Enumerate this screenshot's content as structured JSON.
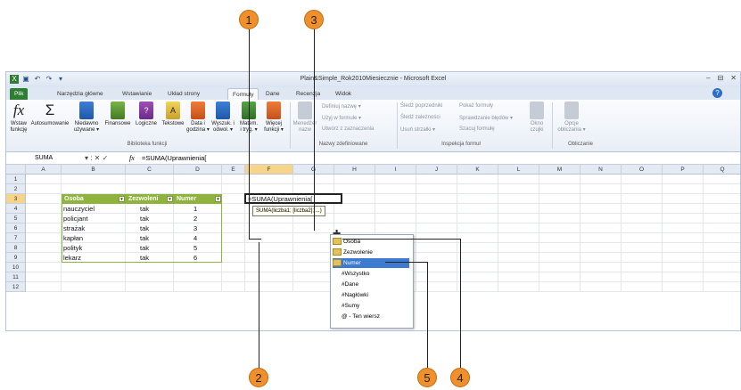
{
  "callouts": [
    "1",
    "2",
    "3",
    "4",
    "5"
  ],
  "window": {
    "title": "Plain&Simple_Rok2010Miesiecznie - Microsoft Excel",
    "controls": [
      "▭",
      "⊟",
      "⊠"
    ]
  },
  "tabs": [
    "Plik",
    "Narzędzia główne",
    "Wstawianie",
    "Układ strony",
    "Formuły",
    "Dane",
    "Recenzja",
    "Widok"
  ],
  "ribbon": {
    "insert_function": [
      "Wstaw",
      "funkcję"
    ],
    "autosum": "Autosumowanie",
    "recent": [
      "Niedawno",
      "używane ▾"
    ],
    "financial": "Finansowe",
    "logical": "Logiczne",
    "text": "Tekstowe",
    "datetime": [
      "Data i",
      "godzina ▾"
    ],
    "lookup": [
      "Wyszuk. i",
      "odwoł. ▾"
    ],
    "math": [
      "Matem.",
      "i tryg. ▾"
    ],
    "more": [
      "Więcej",
      "funkcji ▾"
    ],
    "library_group": "Biblioteka funkcji",
    "name_manager": [
      "Menedżer",
      "nazw"
    ],
    "define_name": "Definiuj nazwę ▾",
    "use_in_formula": "Użyj w formule ▾",
    "create_from_selection": "Utwórz z zaznaczenia",
    "names_group": "Nazwy zdefiniowane",
    "trace_precedents": "Śledź poprzedniki",
    "trace_dependents": "Śledź zależności",
    "remove_arrows": "Usuń strzałki ▾",
    "show_formulas": "Pokaż formuły",
    "error_checking": "Sprawdzanie błędów ▾",
    "evaluate_formula": "Szacuj formułę",
    "audit_group": "Inspekcja formuł",
    "watch_window": [
      "Okno",
      "czujki"
    ],
    "calc_options": [
      "Opcje",
      "obliczania ▾"
    ],
    "calc_group": "Obliczanie"
  },
  "formula_bar": {
    "name_box": "SUMA",
    "buttons": "▾ : ✕ ✓",
    "fx": "fx",
    "formula": "=SUMA(Uprawnienia["
  },
  "columns": [
    "A",
    "B",
    "C",
    "D",
    "E",
    "F",
    "G",
    "H",
    "I",
    "J",
    "K",
    "L",
    "M",
    "N",
    "O",
    "P",
    "Q"
  ],
  "rows": [
    "1",
    "2",
    "3",
    "4",
    "5",
    "6",
    "7",
    "8",
    "9",
    "10",
    "11",
    "12"
  ],
  "table": {
    "headers": [
      "Osoba",
      "Zezwoleni",
      "Numer"
    ],
    "data": [
      [
        "nauczyciel",
        "tak",
        "1"
      ],
      [
        "policjant",
        "tak",
        "2"
      ],
      [
        "strażak",
        "tak",
        "3"
      ],
      [
        "kapłan",
        "tak",
        "4"
      ],
      [
        "polityk",
        "tak",
        "5"
      ],
      [
        "lekarz",
        "tak",
        "6"
      ]
    ]
  },
  "edit_cell": "=SUMA(Uprawnienia[",
  "tooltip": "SUMA(liczba1; [liczba2]; ...)",
  "autocomplete": {
    "items": [
      "Osoba",
      "Zezwolenie",
      "Numer",
      "#Wszystko",
      "#Dane",
      "#Nagłówki",
      "#Sumy",
      "@ - Ten wiersz"
    ],
    "selected_index": 2
  },
  "colors": {
    "callout": "#f0902c",
    "table_header": "#8fb43e",
    "file_tab": "#2e7d32",
    "selection": "#3d7bd0"
  }
}
